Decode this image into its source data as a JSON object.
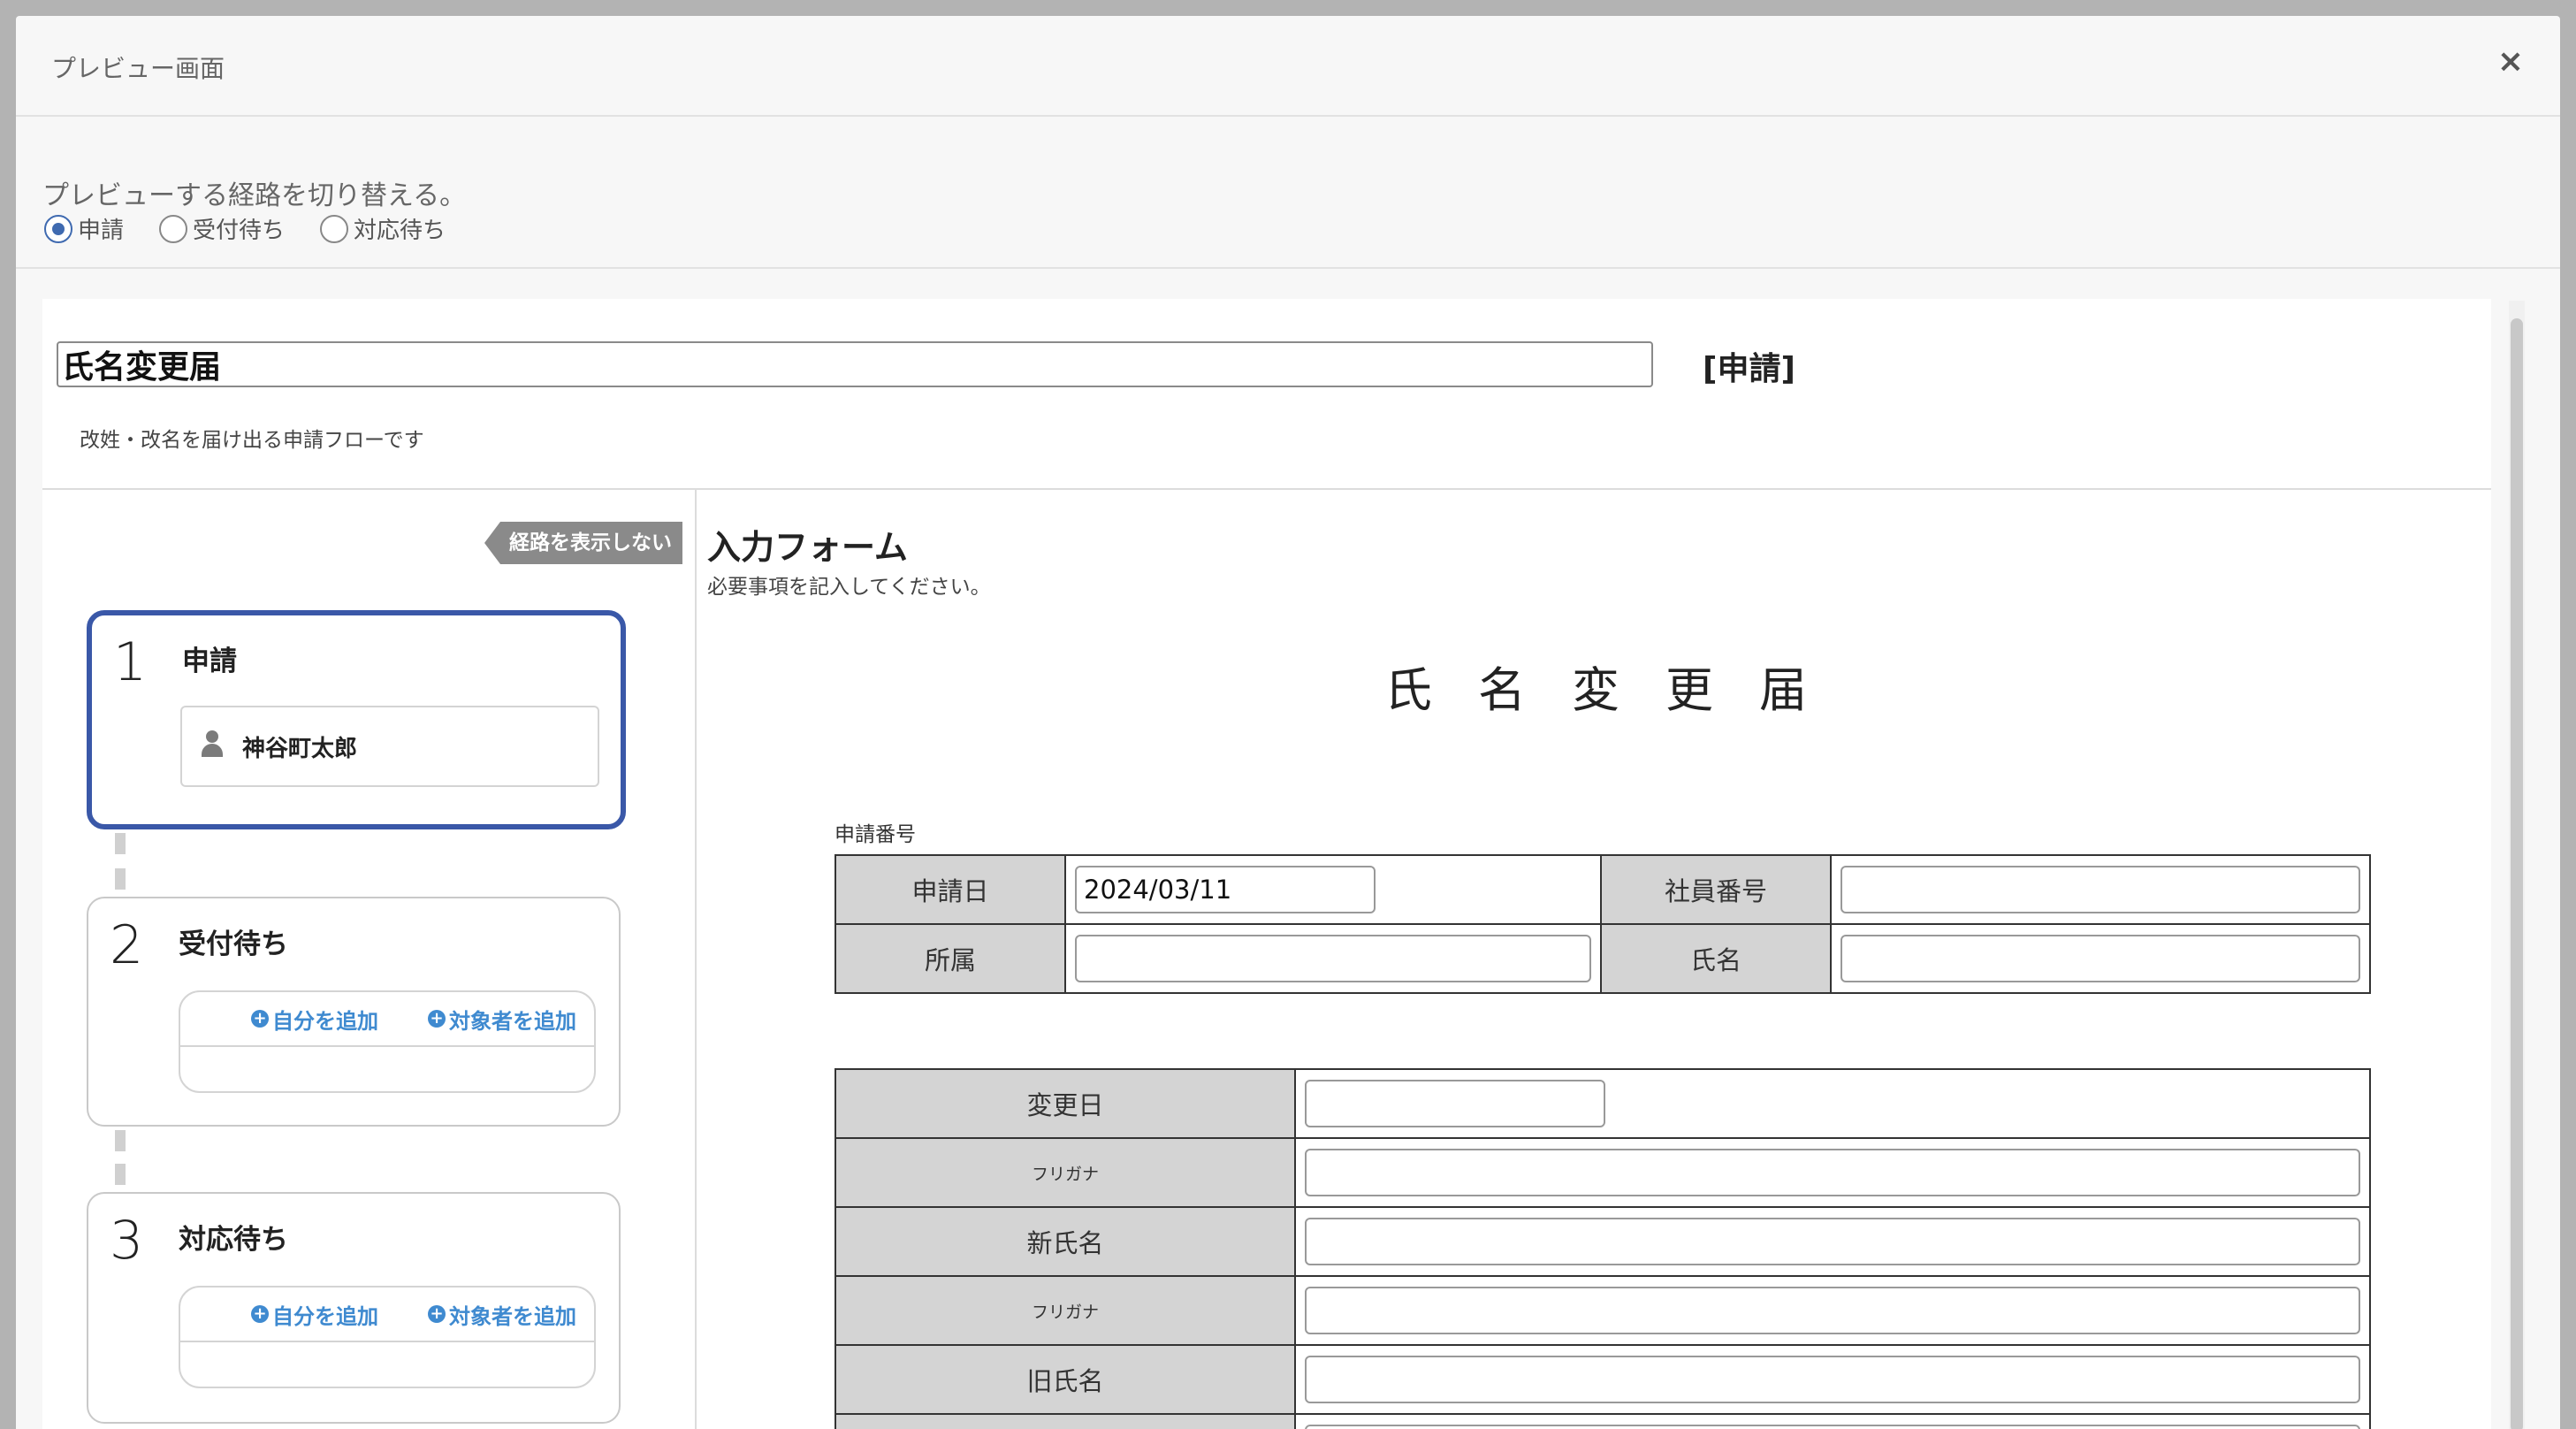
{
  "modal": {
    "title": "プレビュー画面",
    "close": "×"
  },
  "route": {
    "label": "プレビューする経路を切り替える。",
    "options": [
      "申請",
      "受付待ち",
      "対応待ち"
    ],
    "selected": "申請"
  },
  "form_header": {
    "title_value": "氏名変更届",
    "tag": "[申請]",
    "description": "改姓・改名を届け出る申請フローです"
  },
  "sidebar": {
    "hide_route_label": "経路を表示しない",
    "steps": [
      {
        "number": "1",
        "name": "申請",
        "assignee": "神谷町太郎"
      },
      {
        "number": "2",
        "name": "受付待ち",
        "add_self": "自分を追加",
        "add_target": "対象者を追加"
      },
      {
        "number": "3",
        "name": "対応待ち",
        "add_self": "自分を追加",
        "add_target": "対象者を追加"
      }
    ]
  },
  "input_form": {
    "title": "入力フォーム",
    "subtitle": "必要事項を記入してください。",
    "document_title": "氏名変更届",
    "application_number_label": "申請番号",
    "table1": {
      "application_date_label": "申請日",
      "application_date_value": "2024/03/11",
      "employee_no_label": "社員番号",
      "department_label": "所属",
      "name_label": "氏名"
    },
    "table2": {
      "change_date_label": "変更日",
      "furigana_label": "フリガナ",
      "new_name_label": "新氏名",
      "old_name_label": "旧氏名"
    }
  }
}
